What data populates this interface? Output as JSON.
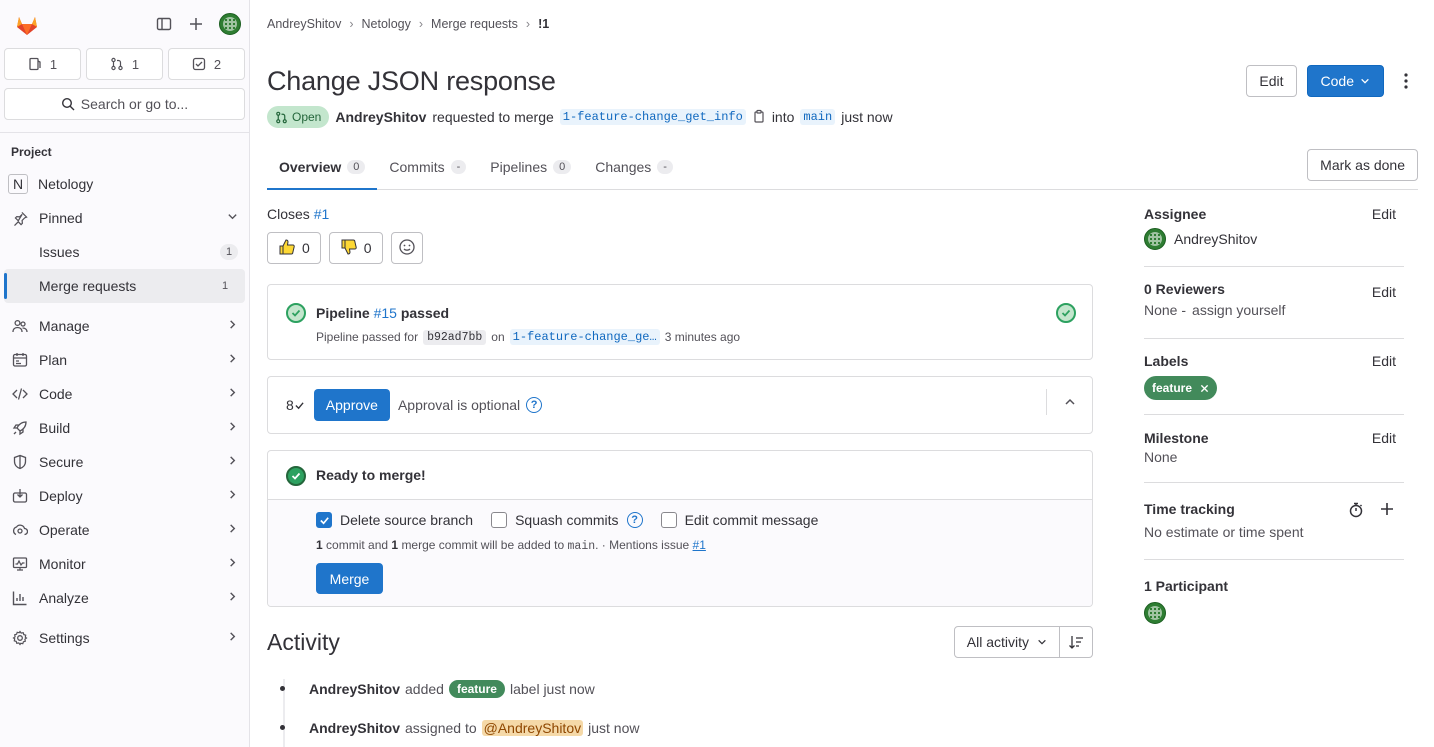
{
  "sidebar": {
    "counts": [
      {
        "icon": "issues-icon",
        "value": "1"
      },
      {
        "icon": "merge-request-icon",
        "value": "1"
      },
      {
        "icon": "todo-icon",
        "value": "2"
      }
    ],
    "search_label": "Search or go to...",
    "section": "Project",
    "project": {
      "initial": "N",
      "name": "Netology"
    },
    "pinned": "Pinned",
    "pinned_items": [
      {
        "label": "Issues",
        "count": "1"
      },
      {
        "label": "Merge requests",
        "count": "1"
      }
    ],
    "nav": [
      "Manage",
      "Plan",
      "Code",
      "Build",
      "Secure",
      "Deploy",
      "Operate",
      "Monitor",
      "Analyze",
      "Settings"
    ]
  },
  "breadcrumbs": [
    "AndreyShitov",
    "Netology",
    "Merge requests",
    "!1"
  ],
  "mr": {
    "title": "Change JSON response",
    "status": "Open",
    "author": "AndreyShitov",
    "requested": "requested to merge",
    "source_branch": "1-feature-change_get_info",
    "into": "into",
    "target_branch": "main",
    "time": "just now"
  },
  "header": {
    "edit": "Edit",
    "code": "Code"
  },
  "tabs": [
    {
      "label": "Overview",
      "badge": "0"
    },
    {
      "label": "Commits",
      "badge": "-"
    },
    {
      "label": "Pipelines",
      "badge": "0"
    },
    {
      "label": "Changes",
      "badge": "-"
    }
  ],
  "mark_done": "Mark as done",
  "closes": {
    "text": "Closes",
    "issue": "#1"
  },
  "reactions": {
    "up": "0",
    "down": "0"
  },
  "pipeline": {
    "label": "Pipeline",
    "id": "#15",
    "status": "passed",
    "passed_for": "Pipeline passed for",
    "sha": "b92ad7bb",
    "on": "on",
    "branch": "1-feature-change_ge…",
    "ago": "3 minutes ago"
  },
  "approval": {
    "count": "8",
    "button": "Approve",
    "optional": "Approval is optional"
  },
  "merge": {
    "ready": "Ready to merge!",
    "delete_source": "Delete source branch",
    "squash": "Squash commits",
    "edit_msg": "Edit commit message",
    "note_n1": "1",
    "note_t1": "commit and",
    "note_n2": "1",
    "note_t2": "merge commit will be added to",
    "note_branch": "main",
    "note_t3": ". · Mentions issue",
    "note_issue": "#1",
    "button": "Merge"
  },
  "activity": {
    "title": "Activity",
    "filter": "All activity",
    "events": [
      {
        "user": "AndreyShitov",
        "action": "added",
        "label": "feature",
        "rest": "label just now"
      },
      {
        "user": "AndreyShitov",
        "action": "assigned to",
        "mention": "@AndreyShitov",
        "rest": "just now"
      }
    ]
  },
  "right": {
    "assignee_h": "Assignee",
    "assignee": "AndreyShitov",
    "reviewers_h": "0 Reviewers",
    "reviewers_none": "None -",
    "assign_yourself": "assign yourself",
    "labels_h": "Labels",
    "label": "feature",
    "milestone_h": "Milestone",
    "milestone": "None",
    "time_h": "Time tracking",
    "time_v": "No estimate or time spent",
    "participants_h": "1 Participant",
    "edit": "Edit"
  },
  "colors": {
    "accent": "#1f75cb",
    "success": "#2da160",
    "label": "#428a5b"
  }
}
